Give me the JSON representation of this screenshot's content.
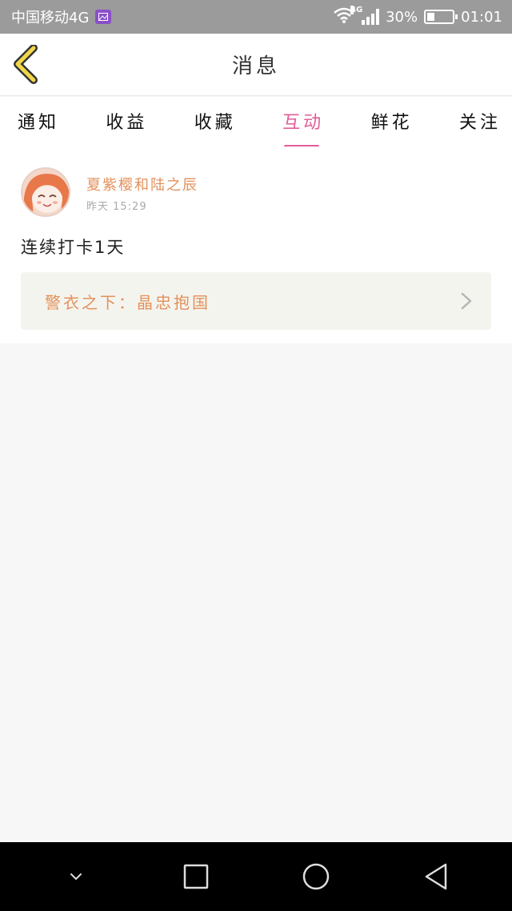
{
  "status_bar": {
    "carrier": "中国移动4G",
    "network_badge": "4G",
    "battery": "30%",
    "battery_level": 0.3,
    "time": "01:01"
  },
  "header": {
    "title": "消息",
    "back_icon": "chevron-left-icon"
  },
  "tabs": [
    {
      "label": "通知",
      "active": false
    },
    {
      "label": "收益",
      "active": false
    },
    {
      "label": "收藏",
      "active": false
    },
    {
      "label": "互动",
      "active": true
    },
    {
      "label": "鲜花",
      "active": false
    },
    {
      "label": "关注",
      "active": false
    }
  ],
  "colors": {
    "accent": "#e25c9a",
    "username": "#e3915b",
    "back_icon": "#f0d84a"
  },
  "interaction": {
    "username": "夏紫樱和陆之辰",
    "timestamp": "昨天  15:29",
    "message": "连续打卡1天",
    "link_title": "警衣之下：晶忠抱国"
  },
  "nav": {
    "items": [
      "chevron-down-icon",
      "square-icon",
      "circle-icon",
      "triangle-back-icon"
    ]
  }
}
